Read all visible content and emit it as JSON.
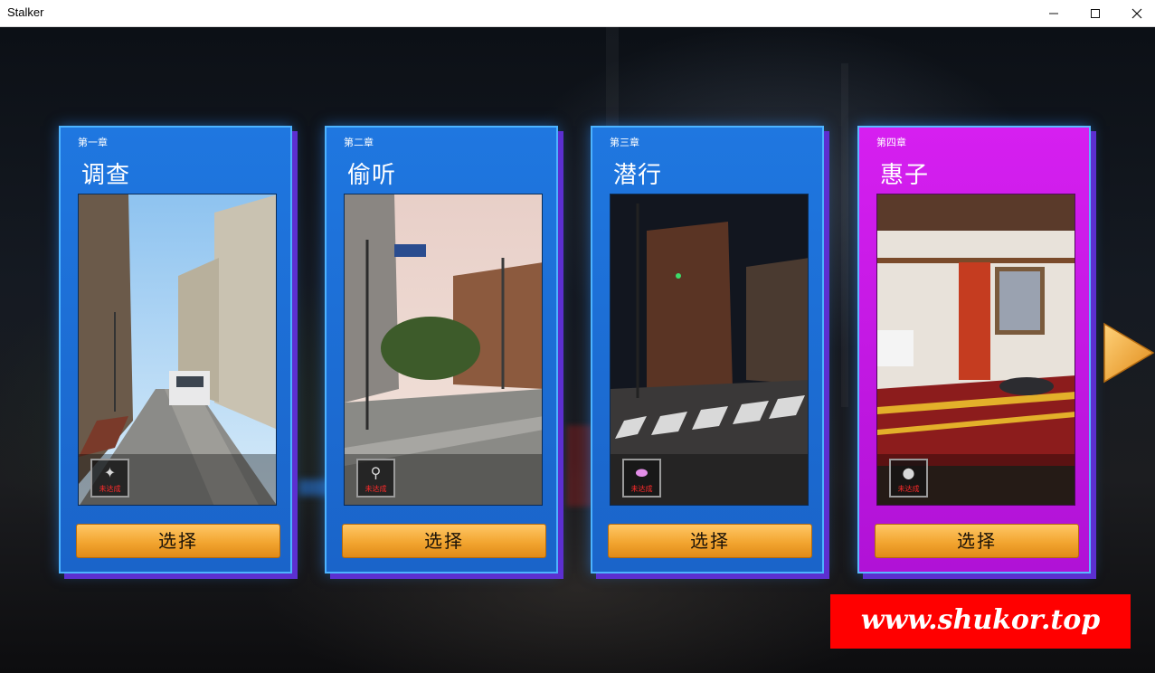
{
  "window": {
    "title": "Stalker",
    "controls": {
      "minimize": "minimize-icon",
      "maximize": "maximize-icon",
      "close": "close-icon"
    }
  },
  "chapters": [
    {
      "chapter": "第一章",
      "name": "调查",
      "item_label": "未达成",
      "item_icon": "crossbow-icon",
      "button": "选择"
    },
    {
      "chapter": "第二章",
      "name": "偷听",
      "item_label": "未达成",
      "item_icon": "screwdriver-icon",
      "button": "选择"
    },
    {
      "chapter": "第三章",
      "name": "潜行",
      "item_label": "未达成",
      "item_icon": "pill-icon",
      "button": "选择"
    },
    {
      "chapter": "第四章",
      "name": "惠子",
      "item_label": "未达成",
      "item_icon": "rock-icon",
      "button": "选择"
    }
  ],
  "navigation": {
    "next_icon": "next-arrow-icon"
  },
  "watermark": "www.shukor.top",
  "colors": {
    "card_blue": "#1f77e0",
    "card_magenta": "#d61ff0",
    "button": "#f2a530",
    "arrow": "#f5a623",
    "watermark": "#ff0000"
  }
}
